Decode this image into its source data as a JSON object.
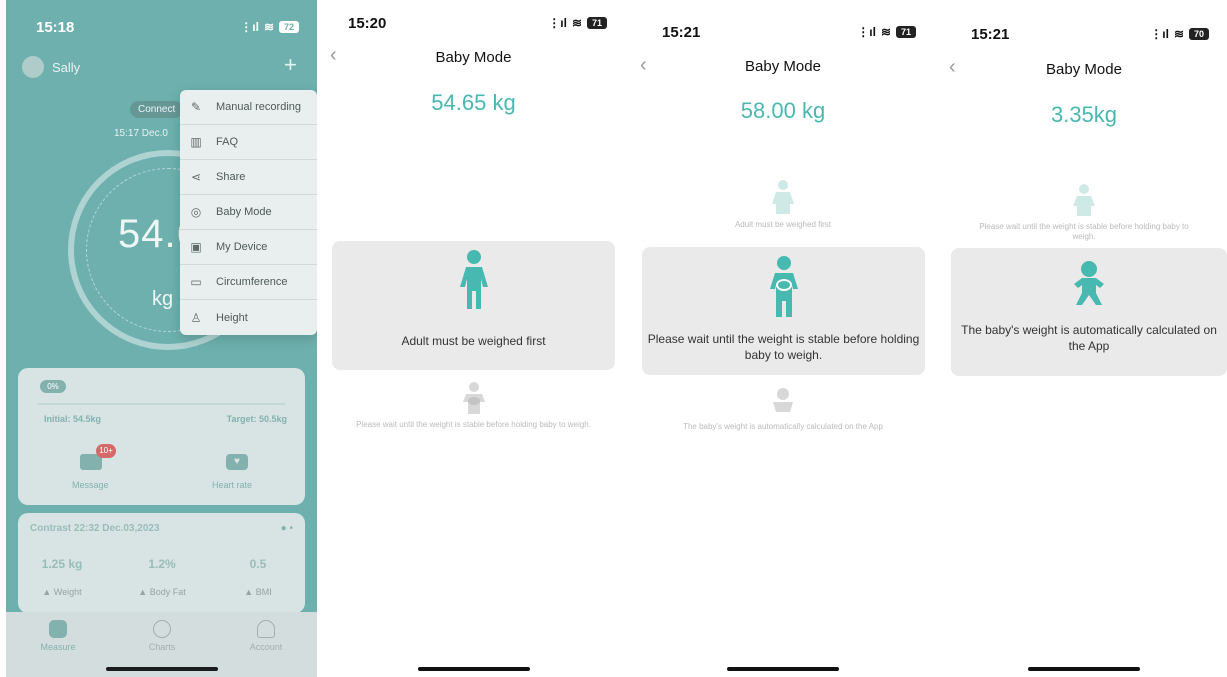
{
  "screen1": {
    "time": "15:18",
    "battery": "72",
    "user": "Sally",
    "connect": "Connect",
    "date": "15:17 Dec.0",
    "weight_display": "54.6",
    "unit": "kg",
    "goal_pill": "0%",
    "initial": "Initial: 54.5kg",
    "target": "Target: 50.5kg",
    "message_label": "Message",
    "message_badge": "10+",
    "heart_label": "Heart rate",
    "contrast_title": "Contrast 22:32 Dec.03,2023",
    "contrast_values": [
      "1.25 kg",
      "1.2%",
      "0.5"
    ],
    "contrast_labels": [
      "▲ Weight",
      "▲ Body Fat",
      "▲ BMI"
    ],
    "tabs": [
      "Measure",
      "Charts",
      "Account"
    ],
    "menu": [
      {
        "icon": "edit-icon",
        "label": "Manual recording"
      },
      {
        "icon": "book-icon",
        "label": "FAQ"
      },
      {
        "icon": "share-icon",
        "label": "Share"
      },
      {
        "icon": "baby-icon",
        "label": "Baby Mode"
      },
      {
        "icon": "device-icon",
        "label": "My Device"
      },
      {
        "icon": "ruler-icon",
        "label": "Circumference"
      },
      {
        "icon": "height-icon",
        "label": "Height"
      }
    ]
  },
  "screen2": {
    "time": "15:20",
    "battery": "71",
    "title": "Baby Mode",
    "weight": "54.65 kg",
    "active_text": "Adult must be weighed first",
    "next_text": "Please wait until the weight is stable before holding baby to weigh."
  },
  "screen3": {
    "time": "15:21",
    "battery": "71",
    "title": "Baby Mode",
    "weight": "58.00 kg",
    "prev_text": "Adult must be weighed first",
    "active_text": "Please wait until the weight is stable before holding baby to weigh.",
    "next_text": "The baby's weight is automatically calculated on the App"
  },
  "screen4": {
    "time": "15:21",
    "battery": "70",
    "title": "Baby Mode",
    "weight": "3.35kg",
    "prev_text": "Please wait until the weight is stable before holding baby to weigh.",
    "active_text": "The baby's weight is automatically calculated on the App"
  },
  "colors": {
    "accent": "#48b9b1",
    "main_bg": "#2f8f8a"
  }
}
